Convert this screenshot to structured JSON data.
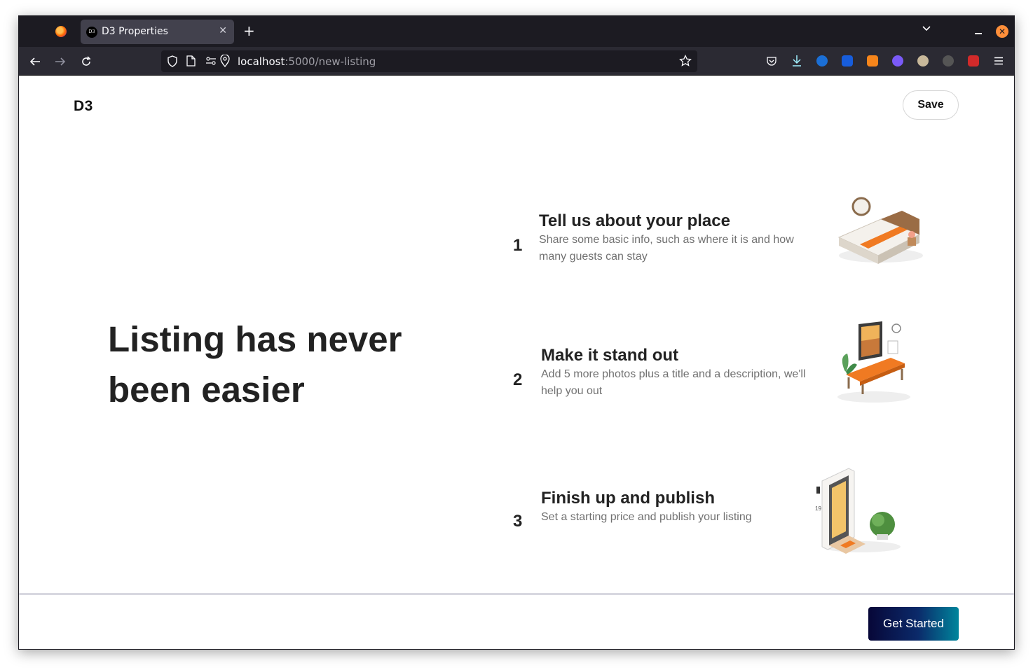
{
  "browser": {
    "tab_title": "D3 Properties",
    "tab_favicon_text": "D3",
    "url_host": "localhost",
    "url_path": ":5000/new-listing",
    "tab_close_glyph": "✕",
    "newtab_glyph": "+",
    "close_glyph": "✕"
  },
  "header": {
    "logo": "D3",
    "save_label": "Save"
  },
  "hero": {
    "heading": "Listing has never been easier"
  },
  "steps": [
    {
      "number": "1",
      "title": "Tell us about your place",
      "description": "Share some basic info, such as where it is and how many guests can stay",
      "illustration": "bed-illustration"
    },
    {
      "number": "2",
      "title": "Make it stand out",
      "description": "Add 5 more photos plus a title and a description, we'll help you out",
      "illustration": "living-room-illustration"
    },
    {
      "number": "3",
      "title": "Finish up and publish",
      "description": "Set a starting price and publish your listing",
      "illustration": "front-door-illustration",
      "door_number": "19"
    }
  ],
  "footer": {
    "cta_label": "Get Started"
  },
  "colors": {
    "browser_dark": "#1c1b22",
    "toolbar": "#2b2a33",
    "cta_gradient_start": "#070738",
    "cta_gradient_end": "#00859c",
    "accent_orange": "#f07a22"
  }
}
